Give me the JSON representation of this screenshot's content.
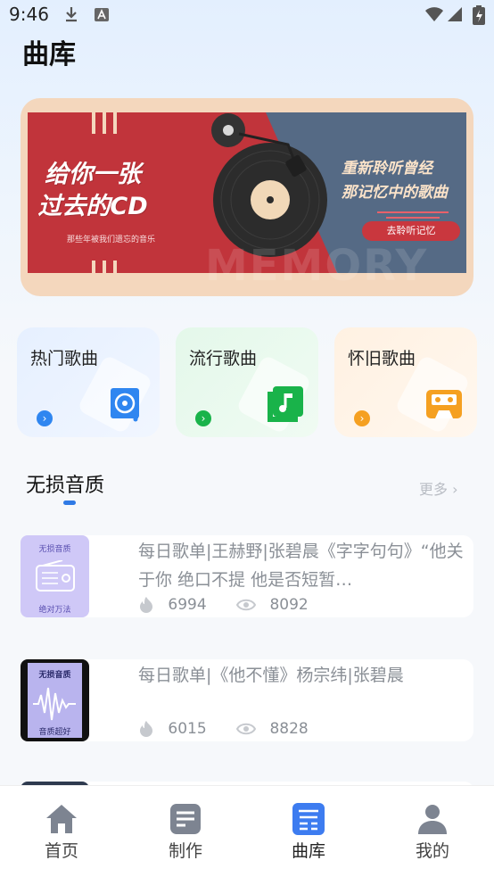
{
  "status_bar": {
    "time": "9:46"
  },
  "page": {
    "title": "曲库"
  },
  "banner": {
    "left_line1": "给你一张",
    "left_line2": "过去的CD",
    "left_small": "那些年被我们遗忘的音乐",
    "right_line1": "重新聆听曾经",
    "right_line2": "那记忆中的歌曲",
    "button": "去聆听记忆",
    "watermark": "MEMORY"
  },
  "categories": [
    {
      "label": "热门歌曲",
      "icon": "cd-music-icon",
      "color": "#2f86f0"
    },
    {
      "label": "流行歌曲",
      "icon": "music-note-icon",
      "color": "#19b34a"
    },
    {
      "label": "怀旧歌曲",
      "icon": "cassette-icon",
      "color": "#f5a021"
    }
  ],
  "section": {
    "title": "无损音质",
    "more": "更多"
  },
  "playlists": [
    {
      "title": "每日歌单|王赫野|张碧晨《字字句句》“他关于你 绝口不提 他是否短暂…",
      "likes": "6994",
      "views": "8092",
      "cover_top": "无损音质",
      "cover_bottom": "绝对万法"
    },
    {
      "title": "每日歌单|《他不懂》杨宗纬|张碧晨",
      "likes": "6015",
      "views": "8828",
      "cover_top": "无损音质",
      "cover_bottom": "音质超好"
    }
  ],
  "tabbar": [
    {
      "label": "首页",
      "icon": "home-icon"
    },
    {
      "label": "制作",
      "icon": "document-icon"
    },
    {
      "label": "曲库",
      "icon": "library-icon",
      "active": true
    },
    {
      "label": "我的",
      "icon": "user-icon"
    }
  ],
  "colors": {
    "accent": "#2f7ae5",
    "banner_red": "#c1343b",
    "banner_blue": "#556a85"
  }
}
